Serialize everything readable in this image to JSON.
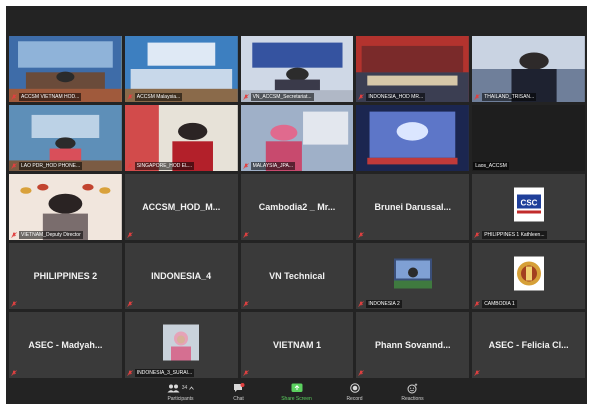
{
  "window": {
    "app": "Zoom Meeting (gallery view)"
  },
  "tiles": [
    {
      "label": "ACCSM VIETNAM HOD...",
      "kind": "video",
      "active": true
    },
    {
      "label": "ACCSM Malaysia...",
      "kind": "video"
    },
    {
      "label": "VN_ACCSM_Secretariat...",
      "kind": "video"
    },
    {
      "label": "INDONESIA_HOD MR...",
      "kind": "video"
    },
    {
      "label": "THAILAND_TRISAN...",
      "kind": "video"
    },
    {
      "label": "LAO PDR_HOD PHONE...",
      "kind": "video"
    },
    {
      "label": "SINGAPORE_HOD EL...",
      "kind": "video"
    },
    {
      "label": "MALAYSIA_JPA...",
      "kind": "video"
    },
    {
      "label": "",
      "kind": "video"
    },
    {
      "label": "Laos_ACCSM",
      "kind": "empty"
    },
    {
      "label": "VIETNAM_Deputy Director",
      "kind": "video"
    },
    {
      "name": "ACCSM_HOD_M...",
      "kind": "name"
    },
    {
      "name": "Cambodia2 _ Mr...",
      "kind": "name"
    },
    {
      "name": "Brunei Darussal...",
      "kind": "name"
    },
    {
      "label": "PHILIPPINES 1 Kathleen...",
      "kind": "thumb",
      "thumb": "csc-logo"
    },
    {
      "name": "PHILIPPINES 2",
      "kind": "name"
    },
    {
      "name": "INDONESIA_4",
      "kind": "name"
    },
    {
      "name": "VN Technical",
      "kind": "name"
    },
    {
      "label": "INDONESIA 2",
      "kind": "thumb",
      "thumb": "photo"
    },
    {
      "label": "CAMBODIA 1",
      "kind": "thumb",
      "thumb": "emblem"
    },
    {
      "name": "ASEC - Madyah...",
      "kind": "name"
    },
    {
      "label": "INDONESIA_3_SURAI...",
      "kind": "thumb",
      "thumb": "person"
    },
    {
      "name": "VIETNAM 1",
      "kind": "name"
    },
    {
      "name": "Phann Sovannd...",
      "kind": "name"
    },
    {
      "name": "ASEC - Felicia Cl...",
      "kind": "name"
    }
  ],
  "toolbar": {
    "participants_label": "Participants",
    "participants_count": "34",
    "chat_label": "Chat",
    "share_label": "Share Screen",
    "record_label": "Record",
    "reactions_label": "Reactions"
  },
  "colors": {
    "share_green": "#5bd15f",
    "active_border": "#e8d23b",
    "mute_red": "#e04040"
  }
}
